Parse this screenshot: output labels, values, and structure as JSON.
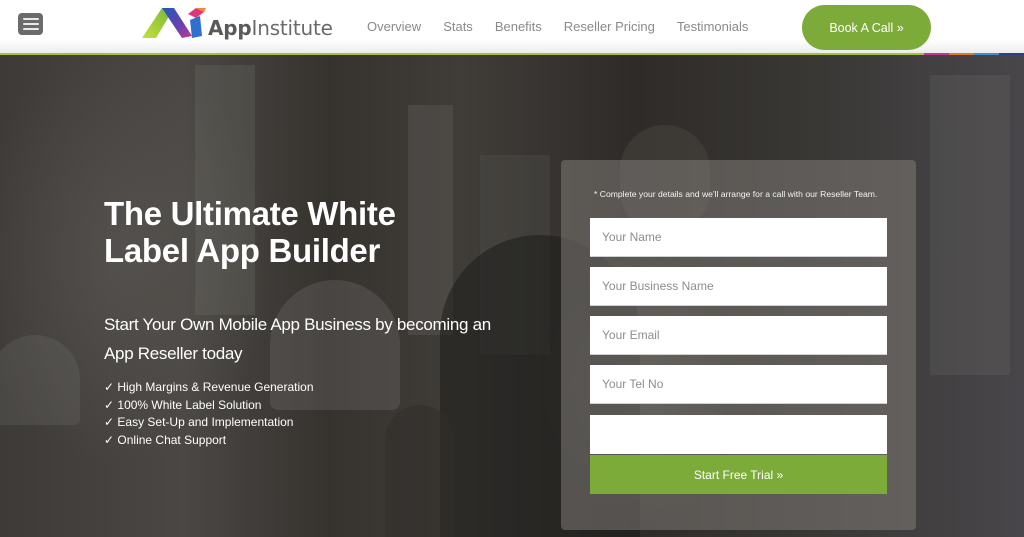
{
  "header": {
    "menu_icon": "hamburger-menu-icon",
    "logo": {
      "text_bold": "App",
      "text_regular": "Institute",
      "icon": "appinstitute-logo-icon"
    },
    "nav": [
      {
        "label": "Overview"
      },
      {
        "label": "Stats"
      },
      {
        "label": "Benefits"
      },
      {
        "label": "Reseller Pricing"
      },
      {
        "label": "Testimonials"
      }
    ],
    "cta_label": "Book A Call »",
    "accent_color": "#7dab3a",
    "underline_color": "#a6c23a",
    "stripe_colors": [
      "#c2378c",
      "#e07a2a",
      "#3f8fd0",
      "#2b3f8c"
    ]
  },
  "hero": {
    "title": "The Ultimate White Label App Builder",
    "subtitle": "Start Your Own Mobile App Business by becoming an App Reseller today",
    "features": [
      "✓ High Margins & Revenue Generation",
      "✓ 100% White Label Solution",
      "✓ Easy Set-Up and Implementation",
      "✓ Online Chat Support"
    ]
  },
  "form": {
    "note": "* Complete your details and we'll arrange for a call with our Reseller Team.",
    "fields": [
      {
        "placeholder": "Your Name",
        "value": ""
      },
      {
        "placeholder": "Your Business Name",
        "value": ""
      },
      {
        "placeholder": "Your Email",
        "value": ""
      },
      {
        "placeholder": "Your Tel No",
        "value": ""
      }
    ],
    "submit_label": "Start Free Trial »"
  }
}
